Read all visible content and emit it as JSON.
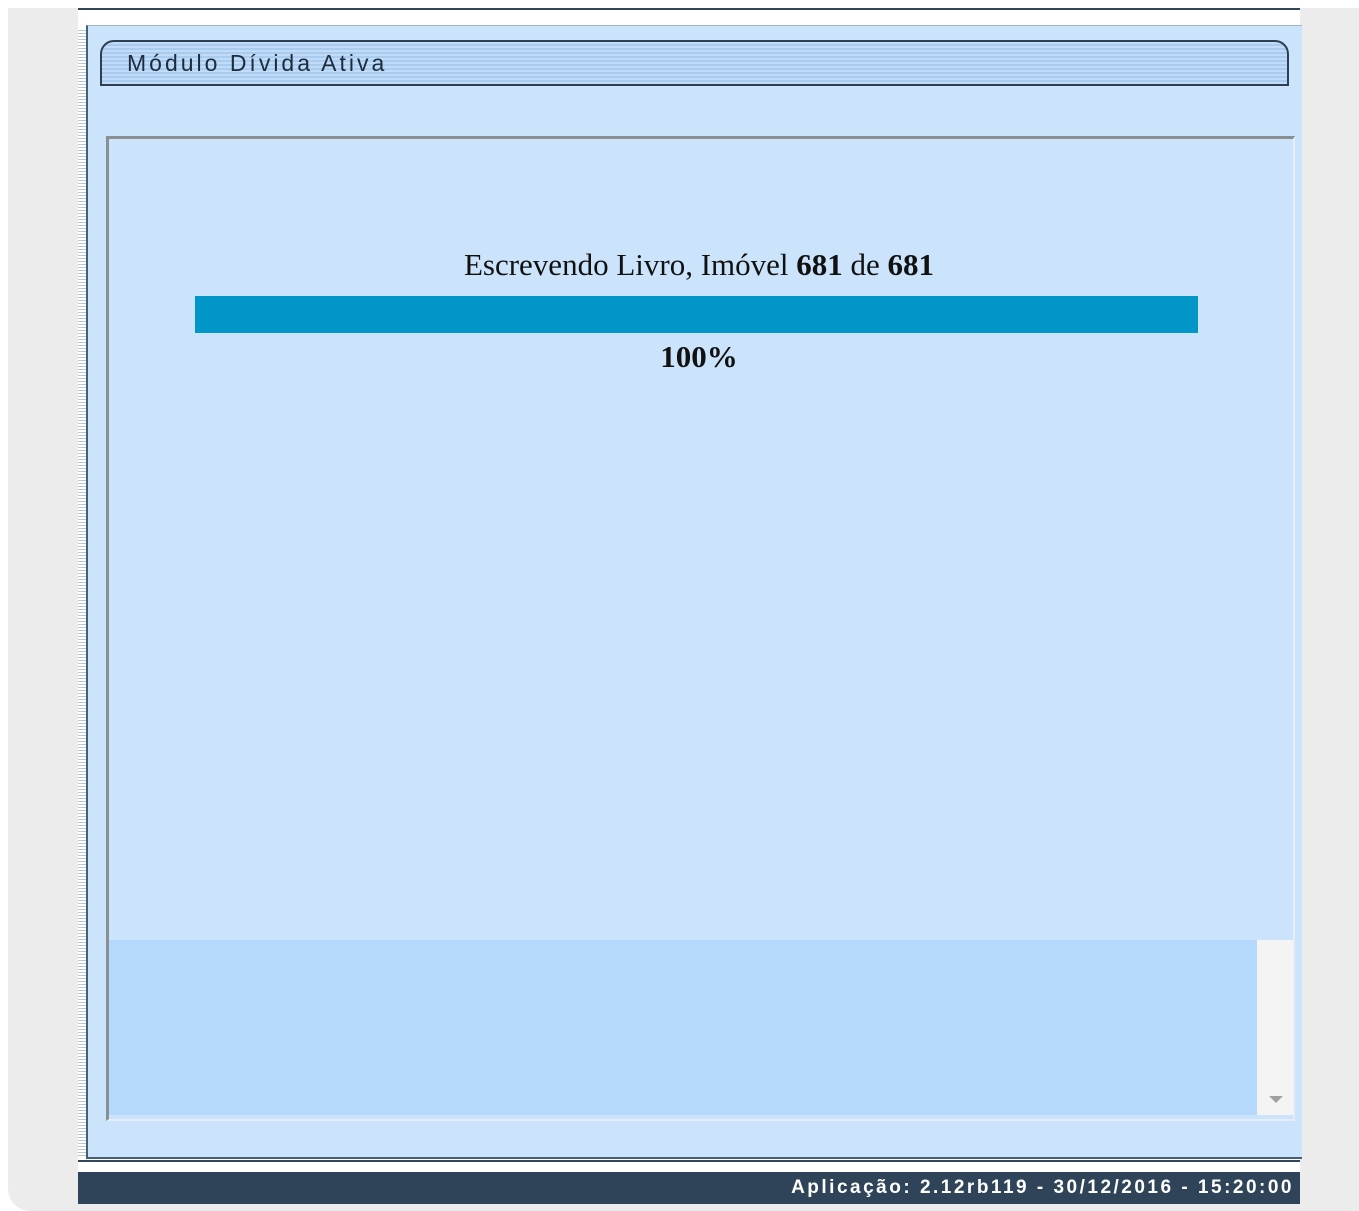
{
  "module": {
    "title": "Módulo Dívida Ativa"
  },
  "progress": {
    "label_prefix": "Escrevendo Livro, Imóvel",
    "current": "681",
    "label_middle": "de",
    "total": "681",
    "percent_text": "100%",
    "percent_value": 100,
    "bar_color": "#0096c8"
  },
  "footer": {
    "app_info": "Aplicação: 2.12rb119 - 30/12/2016 - 15:20:00"
  },
  "icons": {
    "scroll_down": "triangle-down"
  }
}
